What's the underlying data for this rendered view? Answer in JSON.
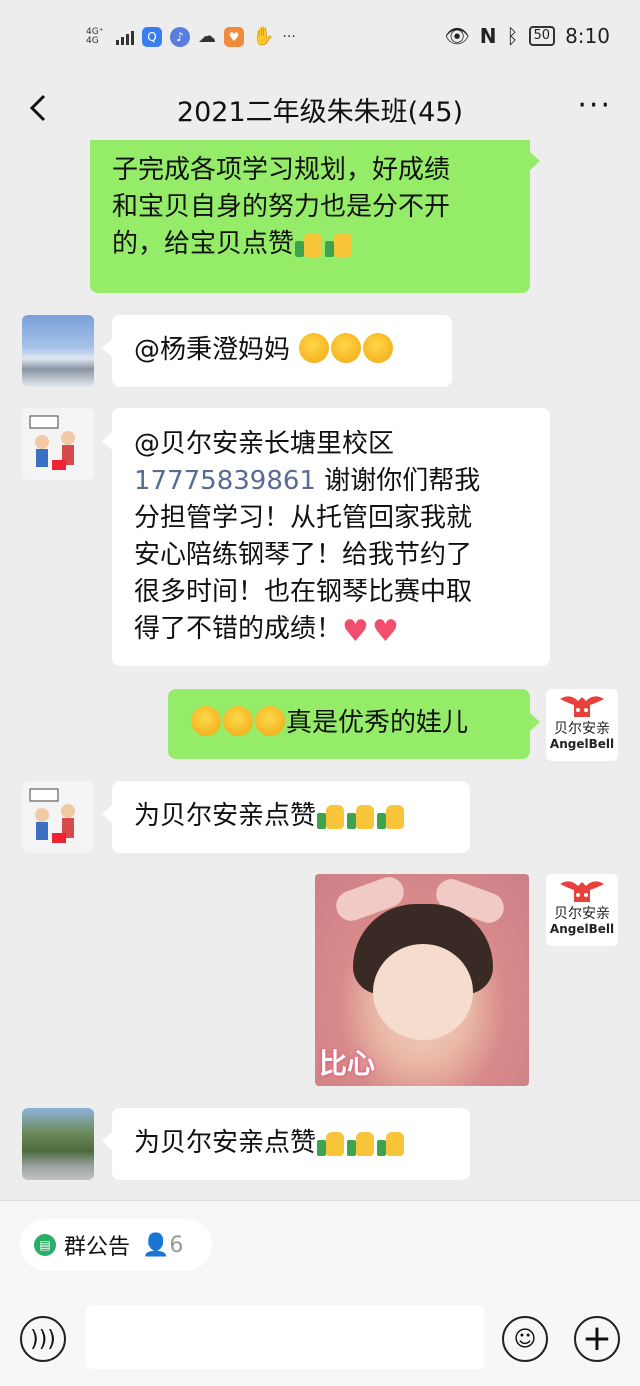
{
  "status_bar": {
    "network": "4G⁺",
    "network2": "4G",
    "time": "8:10",
    "battery": "50",
    "dots": "···"
  },
  "header": {
    "title": "2021二年级朱朱班(45)",
    "more": "···"
  },
  "messages": [
    {
      "side": "out",
      "text": "子完成各项学习规划，好成绩和宝贝自身的努力也是分不开的，给宝贝点赞"
    },
    {
      "side": "in",
      "text": "@杨秉澄妈妈"
    },
    {
      "side": "in",
      "mention": "@贝尔安亲长塘里校区",
      "phone": "17775839861",
      "text": "谢谢你们帮我分担管学习！从托管回家我就安心陪练钢琴了！给我节约了很多时间！也在钢琴比赛中取得了不错的成绩！"
    },
    {
      "side": "out",
      "text": "真是优秀的娃儿"
    },
    {
      "side": "in",
      "text": "为贝尔安亲点赞"
    },
    {
      "side": "out",
      "type": "image",
      "caption": "比心"
    },
    {
      "side": "in",
      "text": "为贝尔安亲点赞"
    }
  ],
  "msg1_lines": [
    "子完成各项学习规划，好成绩",
    "和宝贝自身的努力也是分不开",
    "的，给宝贝点赞"
  ],
  "msg3_lines": [
    "谢谢你们帮我",
    "分担管学习！从托管回家我就",
    "安心陪练钢琴了！给我节约了",
    "很多时间！也在钢琴比赛中取",
    "得了不错的成绩！"
  ],
  "brand": {
    "cn": "贝尔安亲",
    "en": "AngelBell"
  },
  "bottom": {
    "notice_label": "群公告",
    "member_count": "6",
    "plus": "+"
  },
  "colors": {
    "sent_bubble": "#95ec69",
    "received_bubble": "#ffffff",
    "background": "#ededed"
  }
}
